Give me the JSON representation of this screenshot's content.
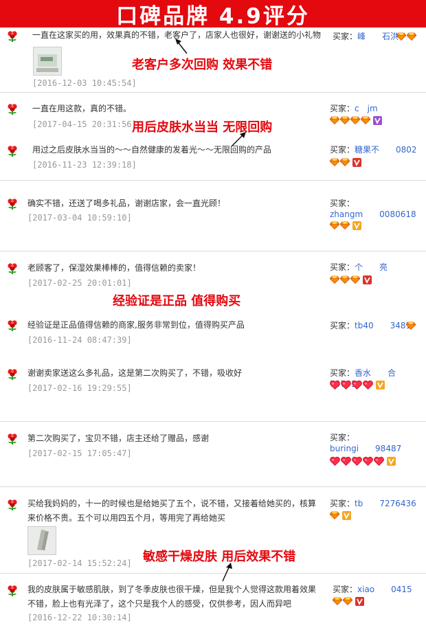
{
  "banner": {
    "title": "口碑品牌  4.9评分"
  },
  "buyer_label": "买家：",
  "annotations": [
    "老客户多次回购 效果不错",
    "用后皮肤水当当 无限回购",
    "经验证是正品 值得购买",
    "敏感干燥皮肤 用后效果不错"
  ],
  "colors": {
    "brand_red": "#e4080f",
    "link_blue": "#3366cc",
    "date_gray": "#999999",
    "diamond_orange": "#ff8a00"
  },
  "reviews": [
    {
      "text": "一直在这家买的用，效果真的不错，老客户了，店家人也很好，谢谢送的小礼物",
      "date": "[2016-12-03 10:45:54]",
      "buyer": "峰　　石洪",
      "badge": "2 diamonds",
      "has_photo": true
    },
    {
      "text": "一直在用这款，真的不错。",
      "date": "[2017-04-15 20:31:56]",
      "buyer": "c　jm",
      "badge": "4 diamonds + vip"
    },
    {
      "text": "用过之后皮肤水当当的～～自然健康的发着光～～无限回购的产品",
      "date": "[2016-11-23 12:39:18]",
      "buyer": "糖果不　　0802",
      "badge": "2 diamonds + vip"
    },
    {
      "text": "确实不错，还送了喝多礼品，谢谢店家，会一直光顾！",
      "date": "[2017-03-04 10:59:10]",
      "buyer": "zhangm　　0080618",
      "badge": "2 diamonds + vip"
    },
    {
      "text": "老顾客了，保湿效果棒棒的，值得信赖的卖家！",
      "date": "[2017-02-25 20:01:01]",
      "buyer": "个　　亮",
      "badge": "3 diamonds + vip"
    },
    {
      "text": "经验证是正品值得信赖的商家,服务非常到位，值得购买产品",
      "date": "[2016-11-24 08:47:39]",
      "buyer": "tb40　　3481",
      "badge": "1 diamond"
    },
    {
      "text": "谢谢卖家送这么多礼品，这是第二次购买了，不错，吸收好",
      "date": "[2017-02-16 19:29:55]",
      "buyer": "香水　　合747610",
      "badge": "4 hearts + vip"
    },
    {
      "text": "第二次购买了，宝贝不错，店主还给了赠品，感谢",
      "date": "[2017-02-15 17:05:47]",
      "buyer": "buringi　　98487",
      "badge": "5 hearts + vip"
    },
    {
      "text": "买给我妈妈的，十一的时候也是给她买了五个，说不错，又接着给她买的，核算来价格不贵。五个可以用四五个月，等用完了再给她买",
      "date": "[2017-02-14 15:52:24]",
      "buyer": "tb　　7276436",
      "badge": "1 diamond + vip",
      "has_photo": true
    },
    {
      "text": "我的皮肤属于敏感肌肤，到了冬季皮肤也很干燥，但是我个人觉得这款用着效果不错，脸上也有光泽了，这个只是我个人的感受，仅供参考，因人而异吧",
      "date": "[2016-12-22 10:30:14]",
      "buyer": "xiao　　0415",
      "badge": "2 diamonds + vip"
    }
  ]
}
